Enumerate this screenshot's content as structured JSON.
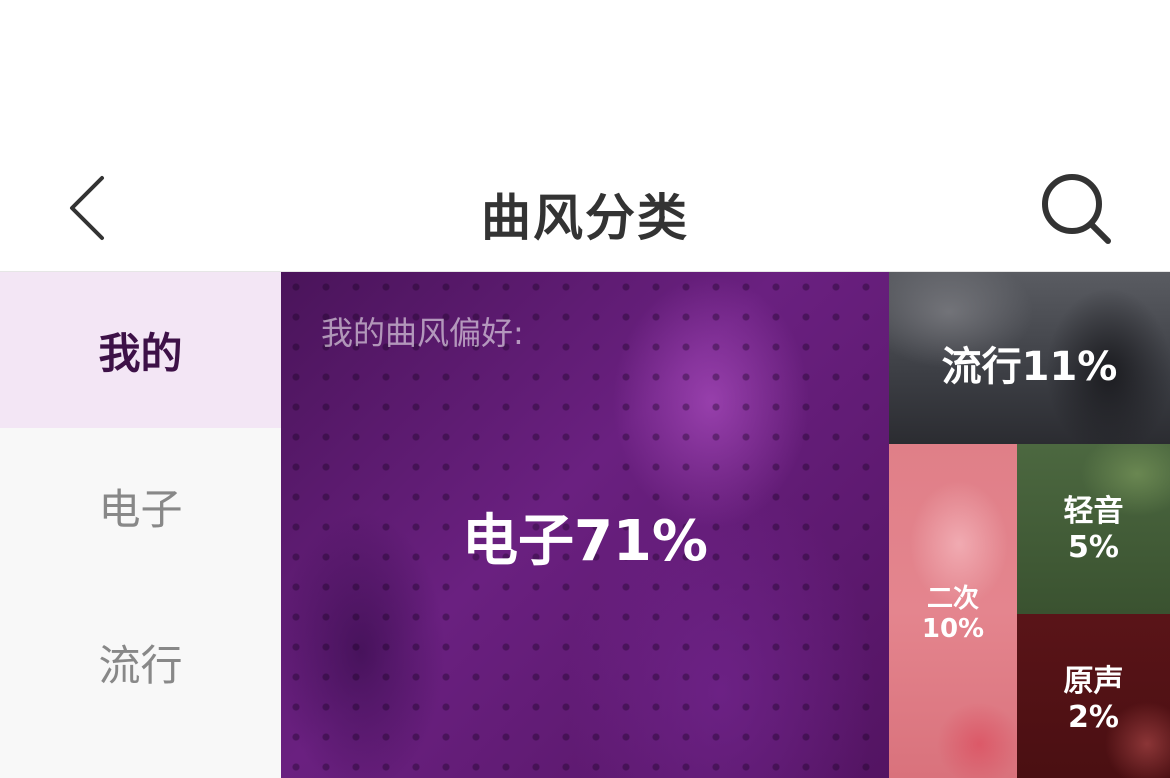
{
  "header": {
    "title": "曲风分类",
    "back_icon": "chevron-left-icon",
    "search_icon": "search-icon"
  },
  "sidebar": {
    "items": [
      {
        "label": "我的",
        "active": true
      },
      {
        "label": "电子",
        "active": false
      },
      {
        "label": "流行",
        "active": false
      }
    ]
  },
  "main": {
    "preference_label": "我的曲风偏好:",
    "tiles": [
      {
        "name": "电子",
        "percent": "71%",
        "label": "电子71%"
      },
      {
        "name": "流行",
        "percent": "11%",
        "label": "流行11%"
      },
      {
        "name": "二次",
        "percent": "10%"
      },
      {
        "name": "轻音",
        "percent": "5%"
      },
      {
        "name": "原声",
        "percent": "2%"
      }
    ]
  },
  "colors": {
    "accent": "#3d1147",
    "active_bg": "#f3e6f5",
    "sidebar_bg": "#f8f8f8",
    "title_text": "#333333"
  }
}
